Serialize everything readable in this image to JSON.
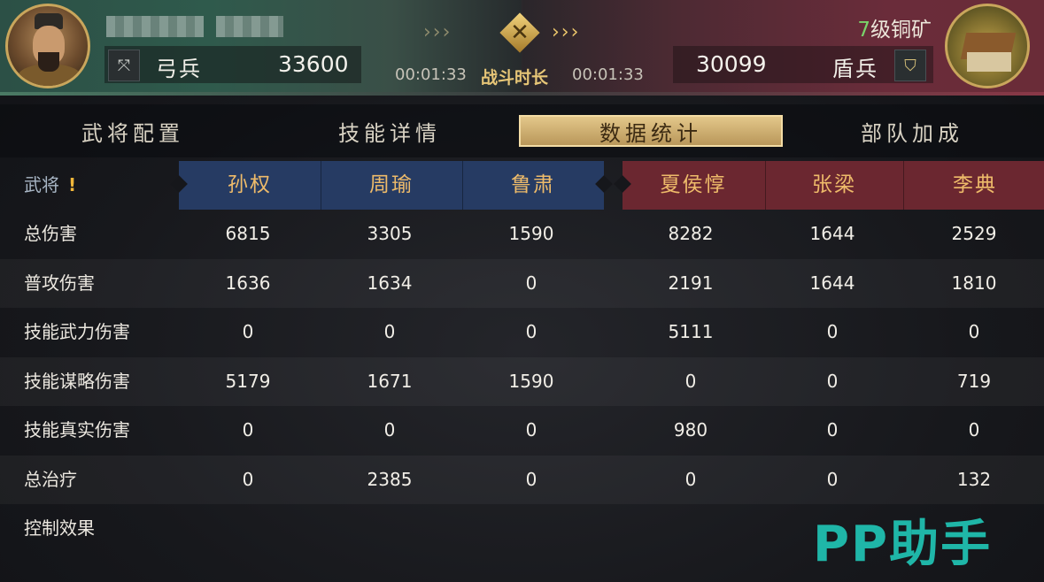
{
  "header": {
    "left": {
      "unit_type": "弓兵",
      "unit_icon": "bow-icon",
      "troops": "33600"
    },
    "right": {
      "level_num": "7",
      "level_text": "级铜矿",
      "unit_type": "盾兵",
      "unit_icon": "shield-icon",
      "troops": "30099"
    },
    "battle": {
      "time_left": "00:01:33",
      "label": "战斗时长",
      "time_right": "00:01:33",
      "chevrons_left": "›››",
      "chevrons_right": "›››",
      "emblem_icon": "crossed-swords-icon"
    }
  },
  "tabs": [
    {
      "label": "武将配置",
      "active": false
    },
    {
      "label": "技能详情",
      "active": false
    },
    {
      "label": "数据统计",
      "active": true
    },
    {
      "label": "部队加成",
      "active": false
    }
  ],
  "table": {
    "header_label": "武将",
    "warning_mark": "!",
    "generals_blue": [
      "孙权",
      "周瑜",
      "鲁肃"
    ],
    "generals_red": [
      "夏侯惇",
      "张梁",
      "李典"
    ],
    "rows": [
      {
        "label": "总伤害",
        "values": [
          "6815",
          "3305",
          "1590",
          "8282",
          "1644",
          "2529"
        ]
      },
      {
        "label": "普攻伤害",
        "values": [
          "1636",
          "1634",
          "0",
          "2191",
          "1644",
          "1810"
        ]
      },
      {
        "label": "技能武力伤害",
        "values": [
          "0",
          "0",
          "0",
          "5111",
          "0",
          "0"
        ]
      },
      {
        "label": "技能谋略伤害",
        "values": [
          "5179",
          "1671",
          "1590",
          "0",
          "0",
          "719"
        ]
      },
      {
        "label": "技能真实伤害",
        "values": [
          "0",
          "0",
          "0",
          "980",
          "0",
          "0"
        ]
      },
      {
        "label": "总治疗",
        "values": [
          "0",
          "2385",
          "0",
          "0",
          "0",
          "132"
        ]
      },
      {
        "label": "控制效果",
        "values": []
      }
    ]
  },
  "watermark": "PP助手",
  "colors": {
    "blue_team": "#263b63",
    "red_team": "#6b2730",
    "accent_gold": "#e3c78a",
    "watermark": "#1fb6a8",
    "level_green": "#7ad36a"
  }
}
